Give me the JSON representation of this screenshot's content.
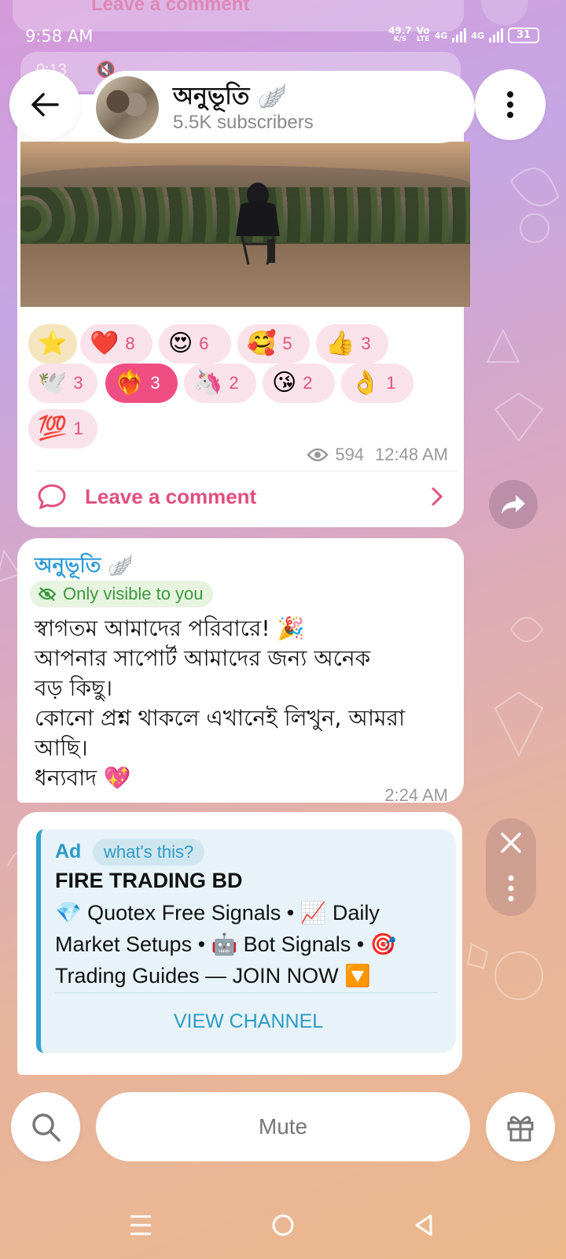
{
  "status_bar": {
    "time": "9:58 AM",
    "speed_value": "49.7",
    "speed_unit": "K/S",
    "volte_top": "Vo",
    "volte_bottom": "LTE",
    "net1": "4G",
    "net2": "4G",
    "battery": "31"
  },
  "header": {
    "channel_name": "অনুভূতি 🪽",
    "subscribers": "5.5K subscribers"
  },
  "top_peek": {
    "comment_label": "Leave a comment",
    "video_time": "0:13"
  },
  "post": {
    "reactions": [
      {
        "emoji": "⭐",
        "count": ""
      },
      {
        "emoji": "❤️",
        "count": "8"
      },
      {
        "emoji": "😍",
        "count": "6"
      },
      {
        "emoji": "🥰",
        "count": "5"
      },
      {
        "emoji": "👍",
        "count": "3"
      },
      {
        "emoji": "🕊️",
        "count": "3"
      },
      {
        "emoji": "❤️‍🔥",
        "count": "3"
      },
      {
        "emoji": "🦄",
        "count": "2"
      },
      {
        "emoji": "😘",
        "count": "2"
      },
      {
        "emoji": "👌",
        "count": "1"
      },
      {
        "emoji": "💯",
        "count": "1"
      }
    ],
    "views": "594",
    "time": "12:48 AM",
    "comment_label": "Leave a comment"
  },
  "message2": {
    "author": "অনুভূতি 🪽",
    "visibility": "Only visible to you",
    "lines": [
      "স্বাগতম আমাদের পরিবারে! 🎉",
      "আপনার সাপোর্ট আমাদের জন্য অনেক",
      "বড় কিছু।",
      "কোনো প্রশ্ন থাকলে এখানেই লিখুন, আমরা",
      "আছি।",
      "ধন্যবাদ 💖"
    ],
    "time": "2:24 AM"
  },
  "ad": {
    "tag": "Ad",
    "whats_this": "what's this?",
    "title": "FIRE TRADING BD",
    "lines": [
      "💎 Quotex Free Signals • 📈 Daily",
      "Market Setups • 🤖 Bot Signals • 🎯",
      "Trading Guides — JOIN NOW 🔽"
    ],
    "cta": "VIEW CHANNEL"
  },
  "bottom": {
    "mute_label": "Mute"
  },
  "colors": {
    "accent_pink": "#e0507e",
    "accent_blue": "#2e9bd6",
    "green": "#3c9a3f"
  }
}
